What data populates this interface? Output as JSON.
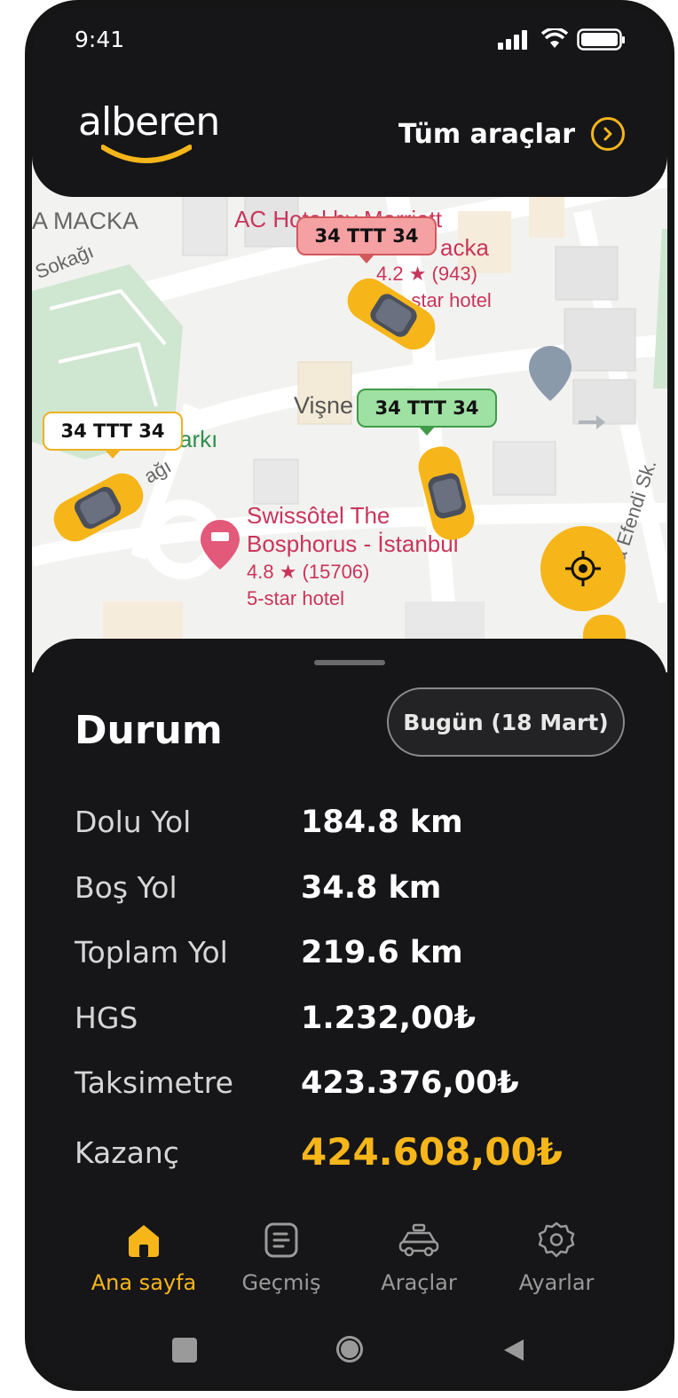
{
  "status_bar": {
    "time": "9:41"
  },
  "header": {
    "logo_text": "alberen",
    "all_vehicles_label": "Tüm araçlar"
  },
  "map": {
    "labels": {
      "macka": "A MACKA",
      "ac_hotel": "AC Hotel by Marriott",
      "macka2": "acka",
      "ac_rating": "4.2 ★ (943)",
      "ac_type": "-star hotel",
      "sokagi": "Sokağı",
      "visne": "Vişne",
      "parki": "arkı",
      "agi": "ağı",
      "swissotel_1": "Swissôtel The",
      "swissotel_2": "Bosphorus - İstanbul",
      "sw_rating": "4.8 ★ (15706)",
      "sw_type": "5-star hotel",
      "efendi": "a Efendi Sk."
    },
    "plates": [
      {
        "text": "34 TTT 34",
        "status": "red"
      },
      {
        "text": "34 TTT 34",
        "status": "green"
      },
      {
        "text": "34 TTT 34",
        "status": "white"
      }
    ]
  },
  "panel": {
    "title": "Durum",
    "date_button": "Bugün (18 Mart)",
    "rows": [
      {
        "label": "Dolu Yol",
        "value": "184.8 km"
      },
      {
        "label": "Boş Yol",
        "value": "34.8 km"
      },
      {
        "label": "Toplam Yol",
        "value": "219.6 km"
      },
      {
        "label": "HGS",
        "value": "1.232,00₺"
      },
      {
        "label": "Taksimetre",
        "value": "423.376,00₺"
      },
      {
        "label": "Kazanç",
        "value": "424.608,00₺"
      }
    ]
  },
  "nav": {
    "items": [
      {
        "label": "Ana sayfa",
        "icon": "home-icon",
        "active": true
      },
      {
        "label": "Geçmiş",
        "icon": "history-icon",
        "active": false
      },
      {
        "label": "Araçlar",
        "icon": "car-icon",
        "active": false
      },
      {
        "label": "Ayarlar",
        "icon": "gear-icon",
        "active": false
      }
    ]
  },
  "colors": {
    "accent": "#f6b61a",
    "background": "#161618",
    "plate_red": "#f5a0a3",
    "plate_green": "#9fe0a3"
  }
}
